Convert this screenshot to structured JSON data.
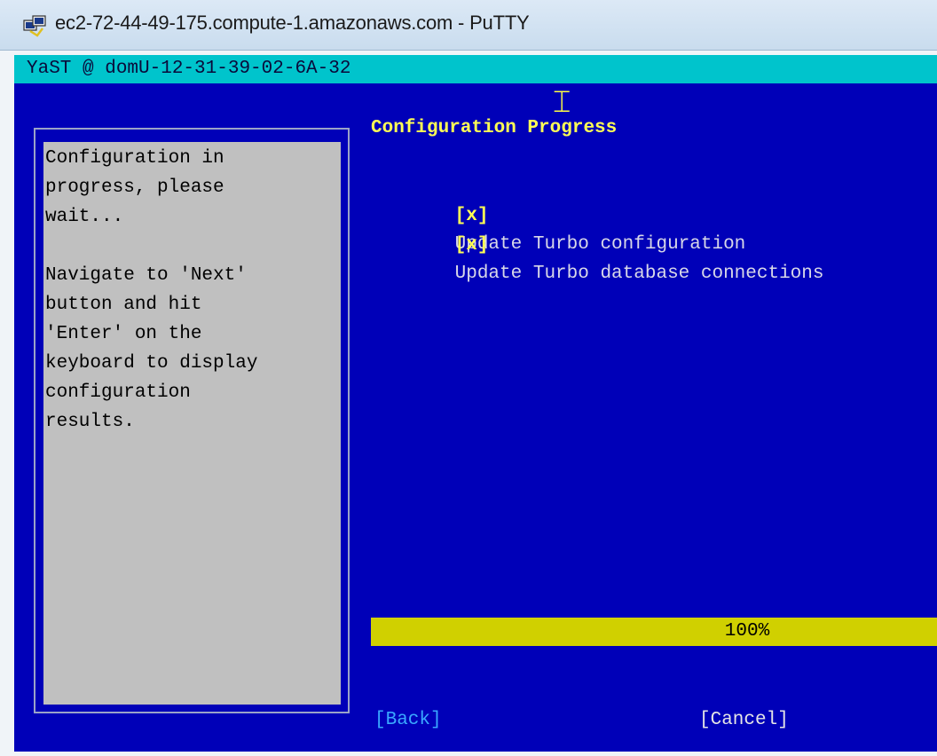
{
  "window": {
    "title": "ec2-72-44-49-175.compute-1.amazonaws.com - PuTTY",
    "icon": "putty-icon"
  },
  "terminal": {
    "host_bar": "YaST @ domU-12-31-39-02-6A-32",
    "help_lines": [
      "Configuration in",
      "progress, please",
      "wait...",
      "",
      "Navigate to 'Next'",
      "button and hit",
      "'Enter' on the",
      "keyboard to display",
      "configuration",
      "results."
    ],
    "heading": "Configuration Progress",
    "tasks": [
      {
        "mark": "[x]",
        "label": "Update Turbo configuration"
      },
      {
        "mark": "[x]",
        "label": "Update Turbo database connections"
      }
    ],
    "progress": {
      "value": 1.0,
      "label": "100%"
    },
    "buttons": {
      "back": "[Back]",
      "cancel": "[Cancel]"
    }
  },
  "colors": {
    "terminal_bg": "#0000b8",
    "host_bar_bg": "#00c4cc",
    "help_bg": "#c0c0c0",
    "heading": "#ffff55",
    "progress": "#d0d000",
    "back_button": "#3aa8ff"
  }
}
